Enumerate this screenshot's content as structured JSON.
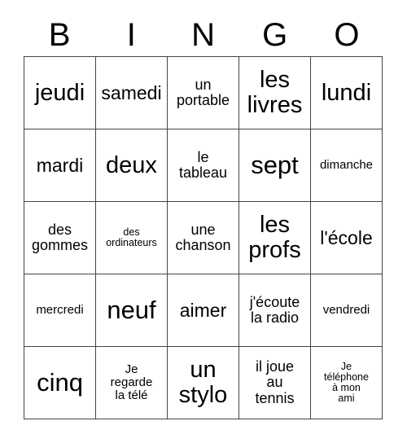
{
  "card": {
    "title": "BINGO card",
    "header_letters": [
      "B",
      "I",
      "N",
      "G",
      "O"
    ],
    "grid_size": "5x5",
    "border_color": "#444444",
    "text_color": "#000000",
    "background_color": "#ffffff",
    "cells": [
      {
        "text": "jeudi",
        "size": "fs-lg"
      },
      {
        "text": "samedi",
        "size": "fs-md"
      },
      {
        "text": "un\nportable",
        "size": "fs-sm"
      },
      {
        "text": "les\nlivres",
        "size": "fs-lg"
      },
      {
        "text": "lundi",
        "size": "fs-lg"
      },
      {
        "text": "mardi",
        "size": "fs-md"
      },
      {
        "text": "deux",
        "size": "fs-lg"
      },
      {
        "text": "le\ntableau",
        "size": "fs-sm"
      },
      {
        "text": "sept",
        "size": "fs-xl"
      },
      {
        "text": "dimanche",
        "size": "fs-xs"
      },
      {
        "text": "des\ngommes",
        "size": "fs-sm"
      },
      {
        "text": "des\nordinateurs",
        "size": "fs-xxs"
      },
      {
        "text": "une\nchanson",
        "size": "fs-sm"
      },
      {
        "text": "les\nprofs",
        "size": "fs-lg"
      },
      {
        "text": "l'école",
        "size": "fs-md"
      },
      {
        "text": "mercredi",
        "size": "fs-xs"
      },
      {
        "text": "neuf",
        "size": "fs-xl"
      },
      {
        "text": "aimer",
        "size": "fs-md"
      },
      {
        "text": "j'écoute\nla radio",
        "size": "fs-sm"
      },
      {
        "text": "vendredi",
        "size": "fs-xs"
      },
      {
        "text": "cinq",
        "size": "fs-xl"
      },
      {
        "text": "Je\nregarde\nla télé",
        "size": "fs-xs"
      },
      {
        "text": "un\nstylo",
        "size": "fs-lg"
      },
      {
        "text": "il joue\nau\ntennis",
        "size": "fs-sm"
      },
      {
        "text": "Je\ntéléphone\nà mon\nami",
        "size": "fs-xxs"
      }
    ]
  }
}
